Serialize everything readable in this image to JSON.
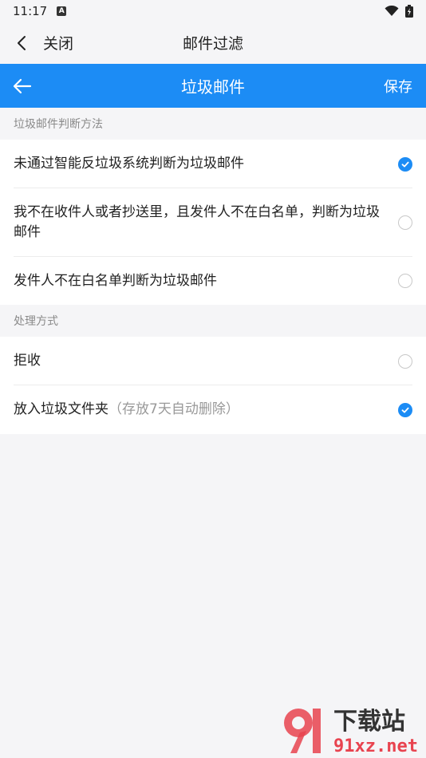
{
  "status_bar": {
    "time": "11:17",
    "indicator": "A"
  },
  "outer_nav": {
    "close_label": "关闭",
    "title": "邮件过滤"
  },
  "header": {
    "title": "垃圾邮件",
    "save_label": "保存"
  },
  "sections": [
    {
      "title": "垃圾邮件判断方法",
      "options": [
        {
          "label": "未通过智能反垃圾系统判断为垃圾邮件",
          "checked": true
        },
        {
          "label": "我不在收件人或者抄送里，且发件人不在白名单，判断为垃圾邮件",
          "checked": false
        },
        {
          "label": "发件人不在白名单判断为垃圾邮件",
          "checked": false
        }
      ]
    },
    {
      "title": "处理方式",
      "options": [
        {
          "label": "拒收",
          "checked": false
        },
        {
          "label": "放入垃圾文件夹",
          "hint": "（存放7天自动删除）",
          "checked": true
        }
      ]
    }
  ],
  "watermark": {
    "brand": "下载站",
    "domain": "91xz.net"
  },
  "colors": {
    "accent": "#1c8cf5",
    "background": "#f5f5f7",
    "watermark_red": "#e8434f"
  }
}
